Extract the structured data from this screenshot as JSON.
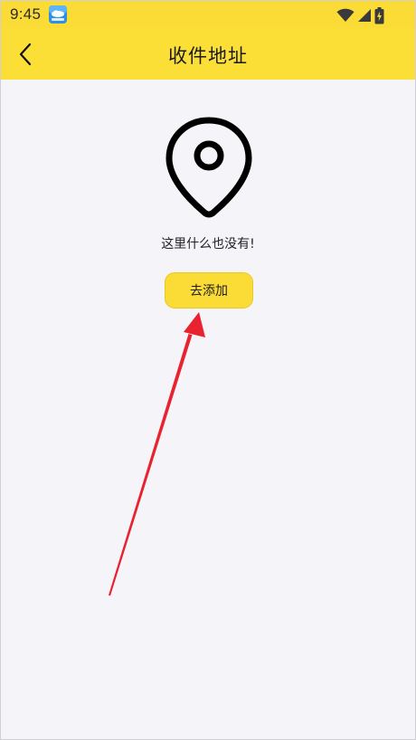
{
  "status_bar": {
    "time": "9:45",
    "app_icon": "weather-app-icon",
    "icons": [
      "wifi-icon",
      "cell-signal-icon",
      "battery-charging-icon"
    ]
  },
  "header": {
    "title": "收件地址",
    "back_icon": "chevron-left-icon"
  },
  "empty_state": {
    "icon": "location-pin-icon",
    "message": "这里什么也没有!",
    "button_label": "去添加"
  },
  "colors": {
    "accent": "#fbdc37",
    "background": "#f5f4f9",
    "annotation_arrow": "#e8232f"
  }
}
